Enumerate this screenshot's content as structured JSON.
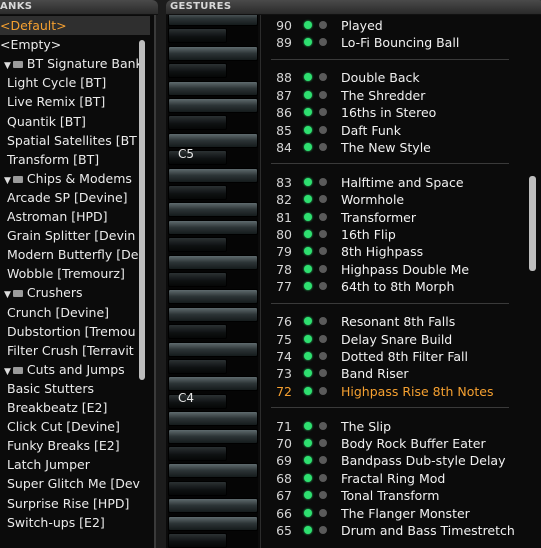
{
  "headers": {
    "banks": "ANKS",
    "gestures": "GESTURES"
  },
  "banks": [
    {
      "label": "<Default>",
      "type": "item",
      "selected": true
    },
    {
      "label": "<Empty>",
      "type": "item"
    },
    {
      "label": "BT Signature Bank",
      "type": "folder"
    },
    {
      "label": "Light Cycle [BT]",
      "type": "child"
    },
    {
      "label": "Live Remix [BT]",
      "type": "child"
    },
    {
      "label": "Quantik [BT]",
      "type": "child"
    },
    {
      "label": "Spatial Satellites [BT",
      "type": "child"
    },
    {
      "label": "Transform [BT]",
      "type": "child"
    },
    {
      "label": "Chips & Modems",
      "type": "folder"
    },
    {
      "label": "Arcade SP [Devine]",
      "type": "child"
    },
    {
      "label": "Astroman [HPD]",
      "type": "child"
    },
    {
      "label": "Grain Splitter [Devin",
      "type": "child"
    },
    {
      "label": "Modern Butterfly [De",
      "type": "child"
    },
    {
      "label": "Wobble [Tremourz]",
      "type": "child"
    },
    {
      "label": "Crushers",
      "type": "folder"
    },
    {
      "label": "Crunch [Devine]",
      "type": "child"
    },
    {
      "label": "Dubstortion [Tremou",
      "type": "child"
    },
    {
      "label": "Filter Crush [Terravit",
      "type": "child"
    },
    {
      "label": "Cuts and Jumps",
      "type": "folder"
    },
    {
      "label": "Basic Stutters",
      "type": "child"
    },
    {
      "label": "Breakbeatz [E2]",
      "type": "child"
    },
    {
      "label": "Click Cut [Devine]",
      "type": "child"
    },
    {
      "label": "Funky Breaks [E2]",
      "type": "child"
    },
    {
      "label": "Latch Jumper",
      "type": "child"
    },
    {
      "label": "Super Glitch Me [Dev",
      "type": "child"
    },
    {
      "label": "Surprise Rise [HPD]",
      "type": "child"
    },
    {
      "label": "Switch-ups [E2]",
      "type": "child"
    }
  ],
  "octave_labels": [
    "C5",
    "C4"
  ],
  "gestures": [
    {
      "num": "90",
      "name": "Played"
    },
    {
      "num": "89",
      "name": "Lo-Fi Bouncing Ball"
    },
    {
      "num": "88",
      "name": "Double Back"
    },
    {
      "num": "87",
      "name": "The Shredder"
    },
    {
      "num": "86",
      "name": "16ths in Stereo"
    },
    {
      "num": "85",
      "name": "Daft Funk"
    },
    {
      "num": "84",
      "name": "The New Style"
    },
    {
      "num": "83",
      "name": "Halftime and Space"
    },
    {
      "num": "82",
      "name": "Wormhole"
    },
    {
      "num": "81",
      "name": "Transformer"
    },
    {
      "num": "80",
      "name": "16th Flip"
    },
    {
      "num": "79",
      "name": "8th Highpass"
    },
    {
      "num": "78",
      "name": "Highpass Double Me"
    },
    {
      "num": "77",
      "name": "64th to 8th Morph"
    },
    {
      "num": "76",
      "name": "Resonant 8th Falls"
    },
    {
      "num": "75",
      "name": "Delay Snare Build"
    },
    {
      "num": "74",
      "name": "Dotted 8th Filter Fall"
    },
    {
      "num": "73",
      "name": "Band Riser"
    },
    {
      "num": "72",
      "name": "Highpass Rise 8th Notes",
      "highlight": true
    },
    {
      "num": "71",
      "name": "The Slip"
    },
    {
      "num": "70",
      "name": "Body Rock Buffer Eater"
    },
    {
      "num": "69",
      "name": "Bandpass Dub-style Delay"
    },
    {
      "num": "68",
      "name": "Fractal Ring Mod"
    },
    {
      "num": "67",
      "name": "Tonal Transform"
    },
    {
      "num": "66",
      "name": "The Flanger Monster"
    },
    {
      "num": "65",
      "name": "Drum and Bass Timestretch"
    }
  ],
  "colors": {
    "accent": "#f5a030",
    "active_dot": "#2ee070",
    "inactive_dot": "#5a5a5a"
  }
}
